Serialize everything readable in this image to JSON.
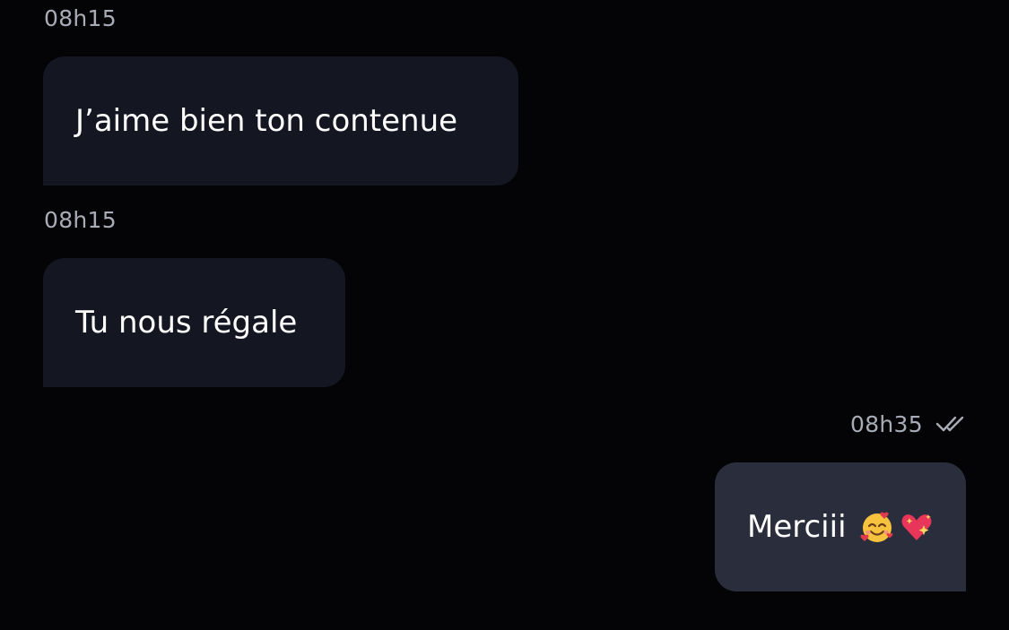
{
  "messages": [
    {
      "time": "08h15",
      "text": "J’aime bien ton contenue",
      "direction": "incoming"
    },
    {
      "time": "08h15",
      "text": "Tu nous régale",
      "direction": "incoming"
    },
    {
      "time": "08h35",
      "text": "Merciii",
      "direction": "outgoing",
      "emojis": [
        "smiling-face-with-hearts",
        "sparkling-heart"
      ],
      "status": "read"
    }
  ],
  "colors": {
    "background": "#040407",
    "incoming_bubble": "#141722",
    "outgoing_bubble": "#292d3c",
    "timestamp": "#a8acb6",
    "text": "#ffffff"
  }
}
